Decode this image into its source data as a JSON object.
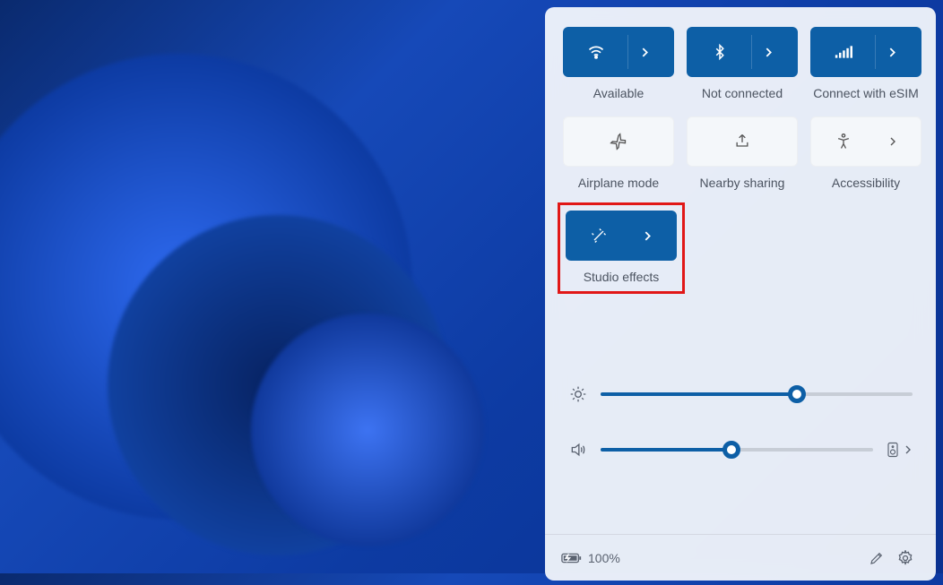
{
  "tiles": {
    "wifi": {
      "label": "Available",
      "hasArrow": true,
      "active": true
    },
    "bt": {
      "label": "Not connected",
      "hasArrow": true,
      "active": true
    },
    "cell": {
      "label": "Connect with eSIM",
      "hasArrow": true,
      "active": true
    },
    "airplane": {
      "label": "Airplane mode",
      "hasArrow": false,
      "active": false
    },
    "nearby": {
      "label": "Nearby sharing",
      "hasArrow": false,
      "active": false
    },
    "access": {
      "label": "Accessibility",
      "hasArrow": true,
      "active": false
    },
    "studio": {
      "label": "Studio effects",
      "hasArrow": true,
      "active": true
    }
  },
  "sliders": {
    "brightness": {
      "value": 63
    },
    "volume": {
      "value": 48
    }
  },
  "footer": {
    "battery": "100%"
  }
}
